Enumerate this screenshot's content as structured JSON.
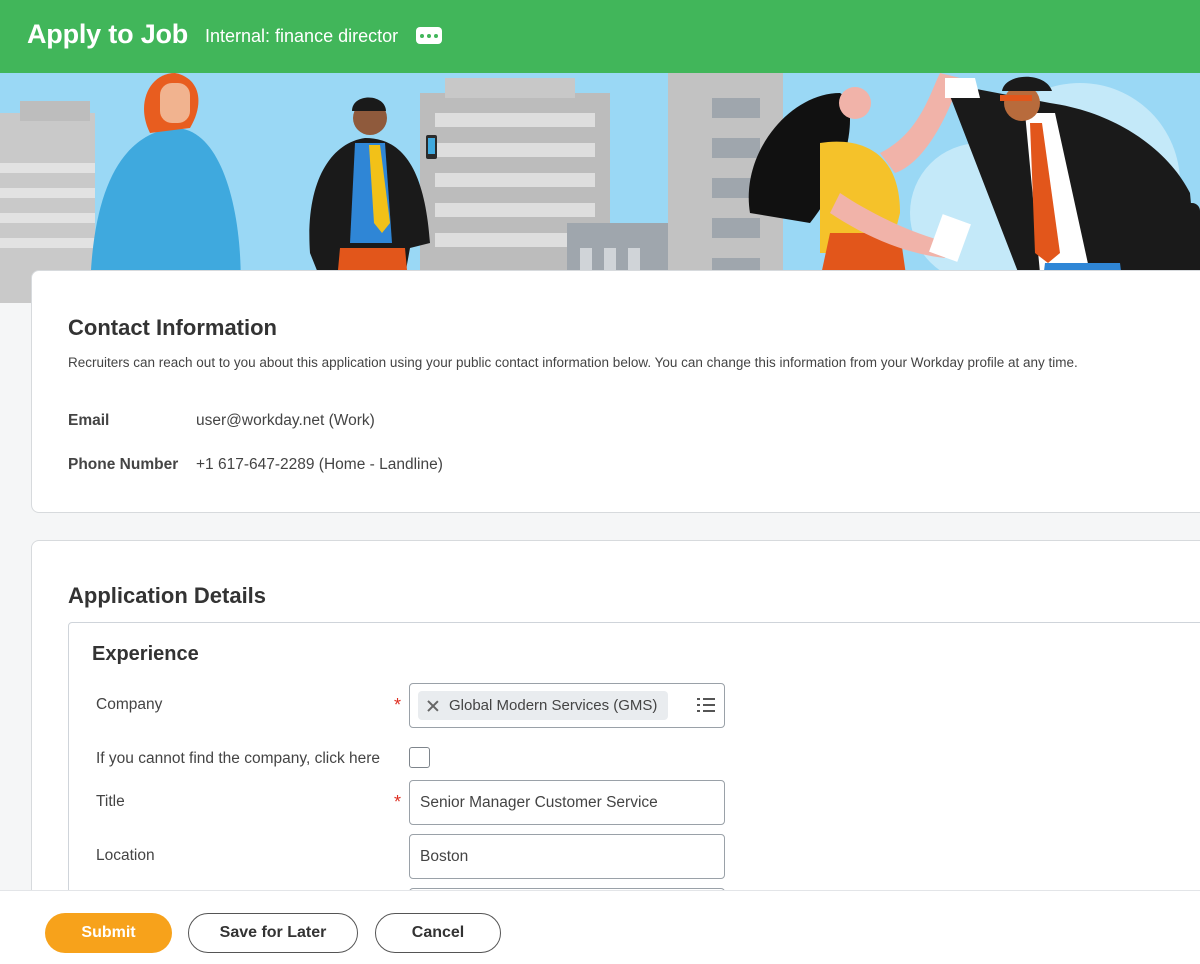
{
  "header": {
    "title": "Apply to Job",
    "subtitle": "Internal: finance director",
    "more_icon": "more-horizontal-icon",
    "color": "#41b65a"
  },
  "contact": {
    "title": "Contact Information",
    "description": "Recruiters can reach out to you about this application using your public contact information below. You can change this information from your Workday profile at any time.",
    "email_label": "Email",
    "email_value": "user@workday.net (Work)",
    "phone_label": "Phone Number",
    "phone_value": "+1 617-647-2289 (Home - Landline)"
  },
  "application": {
    "title": "Application Details",
    "experience": {
      "title": "Experience",
      "company_label": "Company",
      "company_value": "Global Modern Services (GMS)",
      "cannot_find_label": "If you cannot find the company, click here",
      "cannot_find_checked": false,
      "title_label": "Title",
      "title_value": "Senior Manager Customer Service",
      "location_label": "Location",
      "location_value": "Boston",
      "required_mark": "*"
    }
  },
  "footer": {
    "submit_label": "Submit",
    "save_label": "Save for Later",
    "cancel_label": "Cancel",
    "submit_color": "#f7a21b"
  }
}
